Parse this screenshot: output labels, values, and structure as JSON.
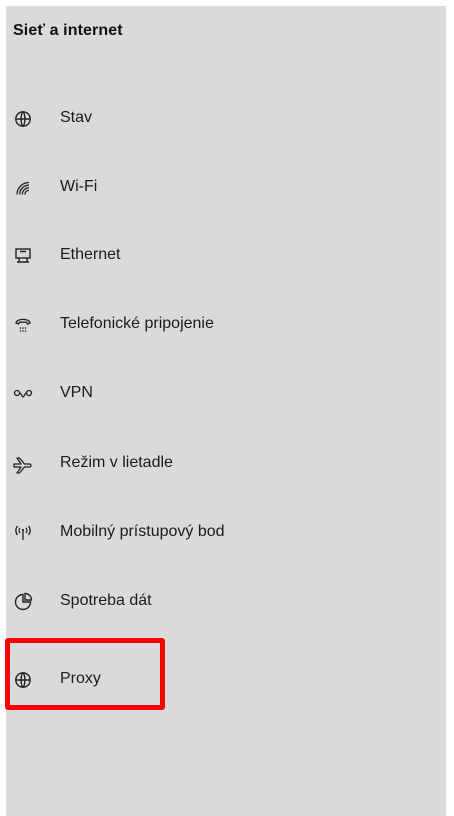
{
  "sidebar": {
    "title": "Sieť a internet",
    "items": [
      {
        "label": "Stav",
        "icon": "globe-icon"
      },
      {
        "label": "Wi-Fi",
        "icon": "wifi-icon"
      },
      {
        "label": "Ethernet",
        "icon": "ethernet-icon"
      },
      {
        "label": "Telefonické pripojenie",
        "icon": "dial-up-icon"
      },
      {
        "label": "VPN",
        "icon": "vpn-icon"
      },
      {
        "label": "Režim v lietadle",
        "icon": "airplane-icon"
      },
      {
        "label": "Mobilný prístupový bod",
        "icon": "hotspot-icon"
      },
      {
        "label": "Spotreba dát",
        "icon": "data-usage-icon"
      },
      {
        "label": "Proxy",
        "icon": "globe-icon"
      }
    ]
  },
  "highlight": {
    "color": "#ff0000"
  }
}
